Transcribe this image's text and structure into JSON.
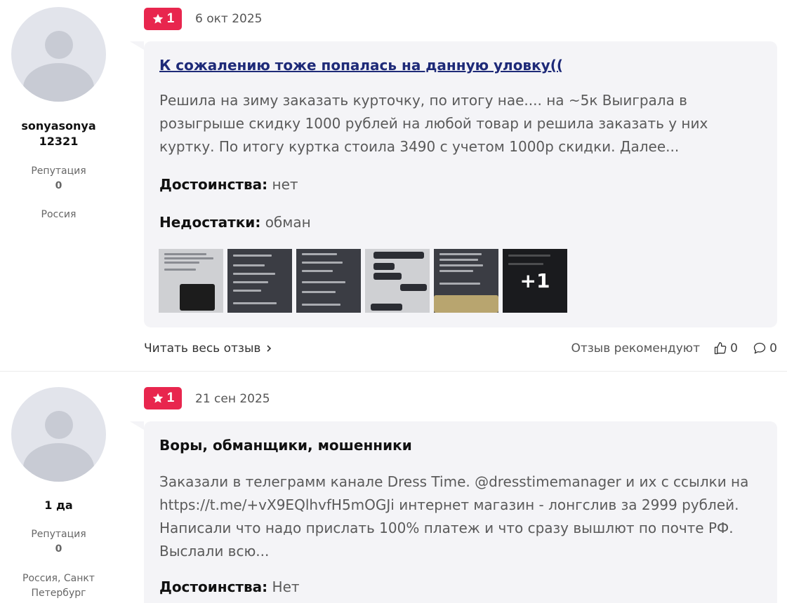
{
  "reviews": [
    {
      "author": "sonyasonya 12321",
      "reputation_label": "Репутация",
      "reputation_value": "0",
      "country": "Россия",
      "rating": "1",
      "date": "6 окт 2025",
      "title": "К сожалению тоже попалась на данную уловку((",
      "text": "Решила на зиму заказать курточку, по итогу нае.... на ~5к Выиграла в розыгрыше скидку 1000 рублей на любой товар и решила заказать у них куртку. По итогу куртка стоила 3490 с учетом 1000р скидки. Далее...",
      "pros_label": "Достоинства:",
      "pros_value": "нет",
      "cons_label": "Недостатки:",
      "cons_value": "обман",
      "more_photos": "+1",
      "read_more": "Читать весь отзыв",
      "recommend_label": "Отзыв рекомендуют",
      "likes": "0",
      "comments": "0"
    },
    {
      "author": "1 да",
      "reputation_label": "Репутация",
      "reputation_value": "0",
      "country": "Россия, Санкт Петербург",
      "rating": "1",
      "date": "21 сен 2025",
      "title": "Воры, обманщики, мошенники",
      "text": "Заказали в телеграмм канале Dress Time. @dresstimemanager и их с ссылки на https://t.me/+vX9EQlhvfH5mOGJi интернет магазин - лонгслив за 2999 рублей. Написали что надо прислать 100% платеж и что сразу вышлют по почте РФ. Выслали всю...",
      "pros_label": "Достоинства:",
      "pros_value": "Нет"
    }
  ],
  "icons": {
    "star": "star-icon",
    "chevron": "chevron-right-icon",
    "like": "thumbs-up-icon",
    "comment": "comment-icon"
  },
  "colors": {
    "rating_badge": "#e8264e",
    "title_link": "#1e2a78",
    "card_bg": "#f4f4f7"
  }
}
